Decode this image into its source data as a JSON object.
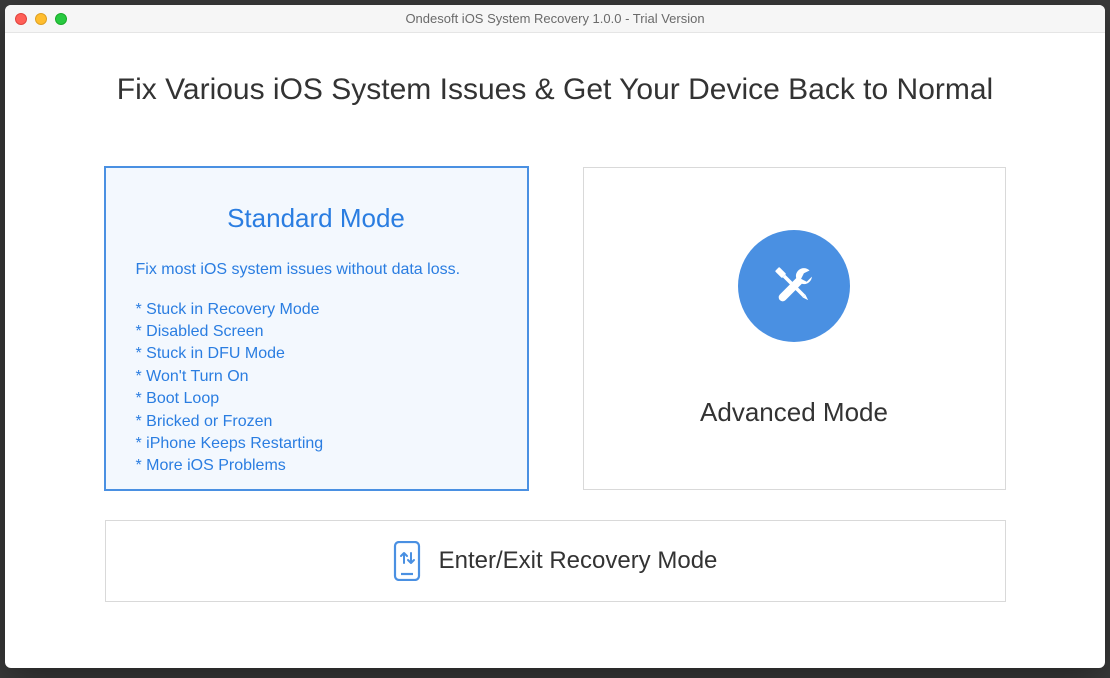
{
  "window": {
    "title": "Ondesoft iOS System Recovery 1.0.0 - Trial Version"
  },
  "heading": "Fix Various iOS System Issues & Get Your Device Back to Normal",
  "standard": {
    "title": "Standard Mode",
    "description": "Fix most iOS system issues without data loss.",
    "items": [
      "* Stuck in Recovery Mode",
      "* Disabled Screen",
      "* Stuck in DFU Mode",
      "* Won't Turn On",
      "* Boot Loop",
      "* Bricked or Frozen",
      "* iPhone Keeps Restarting",
      "* More iOS Problems"
    ]
  },
  "advanced": {
    "title": "Advanced Mode"
  },
  "recovery": {
    "label": "Enter/Exit Recovery Mode"
  },
  "colors": {
    "accent": "#4a90e2",
    "link_blue": "#2a7de1"
  }
}
